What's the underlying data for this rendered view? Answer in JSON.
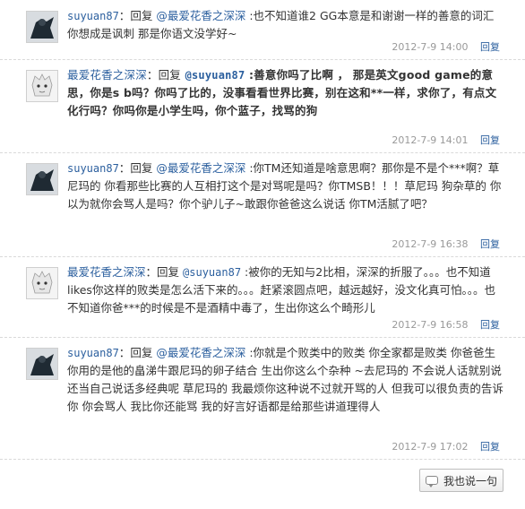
{
  "reply_word": "回复",
  "comments": [
    {
      "username": "suyuan87",
      "reply_to": "@最爱花香之深深",
      "text": ":也不知道谁2 GG本意是和谢谢一样的善意的词汇  你想成是讽刺  那是你语文没学好~",
      "timestamp": "2012-7-9 14:00",
      "reply_label": "回复"
    },
    {
      "username": "最爱花香之深深",
      "reply_to": "@suyuan87",
      "text": ":善意你吗了比啊  ，  那是英文good game的意思，你是s b吗？你吗了比的，没事看看世界比赛，别在这和**一样，求你了，有点文化行吗？你吗你是小学生吗，你个蓝子，找骂的狗",
      "timestamp": "2012-7-9 14:01",
      "reply_label": "回复"
    },
    {
      "username": "suyuan87",
      "reply_to": "@最爱花香之深深",
      "text": ":你TM还知道是啥意思啊？那你是不是个***啊？草尼玛的 你看那些比赛的人互相打这个是对骂呢是吗？你TMSB！！！草尼玛 狗杂草的 你以为就你会骂人是吗？你个驴儿子~敢跟你爸爸这么说话 你TM活腻了吧？",
      "timestamp": "2012-7-9 16:38",
      "reply_label": "回复"
    },
    {
      "username": "最爱花香之深深",
      "reply_to": "@suyuan87",
      "text": ":被你的无知与2比相，深深的折服了。。。也不知道likes你这样的败类是怎么活下来的。。。赶紧滚圆点吧，越远越好，没文化真可怕。。。也不知道你爸***的时候是不是酒精中毒了，生出你这么个畸形儿",
      "timestamp": "2012-7-9 16:58",
      "reply_label": "回复"
    },
    {
      "username": "suyuan87",
      "reply_to": "@最爱花香之深深",
      "text": ":你就是个败类中的败类  你全家都是败类  你爸爸生你用的是他的畠涕牛跟尼玛的卵子结合  生出你这么个杂种 ~去尼玛的 不会说人话就别说  还当自己说话多经典呢  草尼玛的  我最烦你这种说不过就开骂的人  但我可以很负责的告诉你  你会骂人  我比你还能骂  我的好言好语都是给那些讲道理得人",
      "timestamp": "2012-7-9 17:02",
      "reply_label": "回复"
    }
  ],
  "say_button": "我也说一句",
  "colors": {
    "link": "#2b5f9e",
    "meta": "#999999",
    "text": "#333333"
  }
}
